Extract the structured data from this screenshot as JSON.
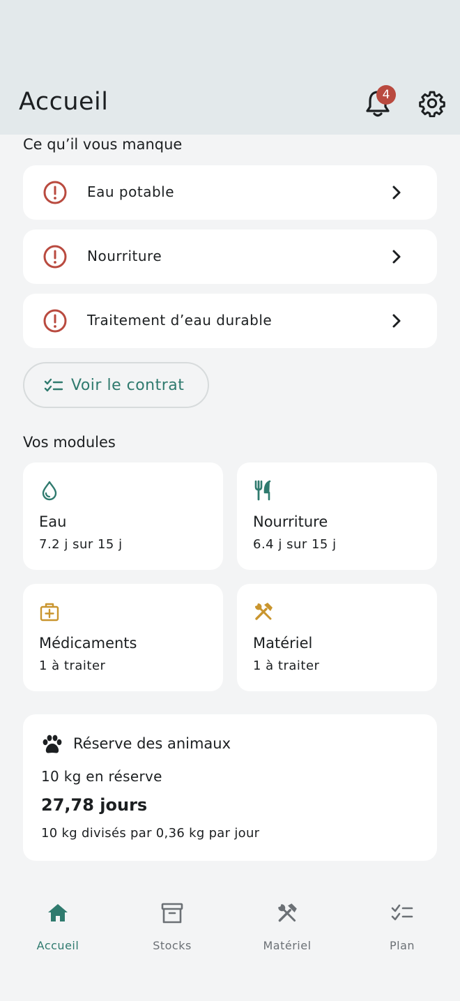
{
  "header": {
    "title": "Accueil",
    "notifications_count": "4"
  },
  "missing": {
    "title": "Ce qu’il vous manque",
    "items": [
      {
        "label": "Eau potable"
      },
      {
        "label": "Nourriture"
      },
      {
        "label": "Traitement d’eau durable"
      }
    ],
    "contract_button": "Voir le contrat"
  },
  "modules": {
    "title": "Vos modules",
    "items": [
      {
        "title": "Eau",
        "subtitle": "7.2 j sur 15 j",
        "icon": "water-drop-icon"
      },
      {
        "title": "Nourriture",
        "subtitle": "6.4 j sur 15 j",
        "icon": "cutlery-icon"
      },
      {
        "title": "Médicaments",
        "subtitle": "1 à traiter",
        "icon": "medical-kit-icon"
      },
      {
        "title": "Matériel",
        "subtitle": "1 à traiter",
        "icon": "tools-icon"
      }
    ]
  },
  "reserve": {
    "title": "Réserve des animaux",
    "amount": "10 kg en réserve",
    "days": "27,78 jours",
    "calculation": "10 kg divisés par 0,36 kg par jour"
  },
  "nav": {
    "items": [
      {
        "label": "Accueil",
        "icon": "home-icon",
        "active": true
      },
      {
        "label": "Stocks",
        "icon": "archive-box-icon",
        "active": false
      },
      {
        "label": "Matériel",
        "icon": "tools-icon",
        "active": false
      },
      {
        "label": "Plan",
        "icon": "checklist-icon",
        "active": false
      }
    ]
  },
  "colors": {
    "accent": "#2f7a6e",
    "alert": "#b94a3f",
    "warning_icon": "#c9952e",
    "header_bg": "#e3e9eb",
    "page_bg": "#f3f4f5",
    "nav_inactive": "#6b7075"
  }
}
